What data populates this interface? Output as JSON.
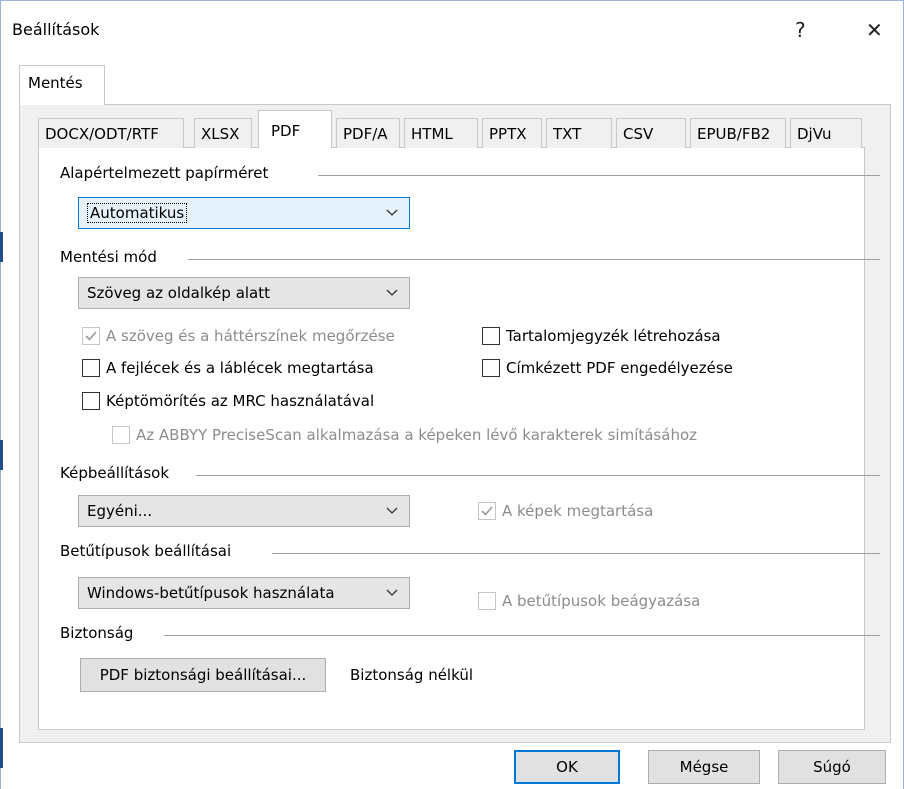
{
  "window": {
    "title": "Beállítások",
    "help_glyph": "?",
    "close_glyph": "✕"
  },
  "outer_tab": {
    "label": "Mentés"
  },
  "format_tabs": [
    "DOCX/ODT/RTF",
    "XLSX",
    "PDF",
    "PDF/A",
    "HTML",
    "PPTX",
    "TXT",
    "CSV",
    "EPUB/FB2",
    "DjVu"
  ],
  "paper": {
    "label": "Alapértelmezett papírméret",
    "value": "Automatikus"
  },
  "save_mode": {
    "label": "Mentési mód",
    "value": "Szöveg az oldalkép alatt",
    "options": {
      "keep_colors": {
        "label": "A szöveg és a háttérszínek megőrzése",
        "checked": true,
        "enabled": false
      },
      "keep_headers": {
        "label": "A fejlécek és a láblécek megtartása",
        "checked": false,
        "enabled": true
      },
      "mrc": {
        "label": "Képtömörítés az MRC használatával",
        "checked": false,
        "enabled": true
      },
      "precisescan": {
        "label": "Az ABBYY PreciseScan alkalmazása a képeken lévő karakterek simításához",
        "checked": false,
        "enabled": false
      },
      "toc": {
        "label": "Tartalomjegyzék létrehozása",
        "checked": false,
        "enabled": true
      },
      "tagged_pdf": {
        "label": "Címkézett PDF engedélyezése",
        "checked": false,
        "enabled": true
      }
    }
  },
  "images": {
    "label": "Képbeállítások",
    "value": "Egyéni...",
    "keep_images": {
      "label": "A képek megtartása",
      "checked": true,
      "enabled": false
    }
  },
  "fonts": {
    "label": "Betűtípusok beállításai",
    "value": "Windows-betűtípusok használata",
    "embed": {
      "label": "A betűtípusok beágyazása",
      "checked": false,
      "enabled": false
    }
  },
  "security": {
    "label": "Biztonság",
    "button": "PDF biztonsági beállításai...",
    "status": "Biztonság nélkül"
  },
  "footer": {
    "ok": "OK",
    "cancel": "Mégse",
    "help": "Súgó"
  },
  "colors": {
    "accent": "#0078d7",
    "panel_bg": "#f0f0f0",
    "disabled_text": "#8c8c8c"
  }
}
